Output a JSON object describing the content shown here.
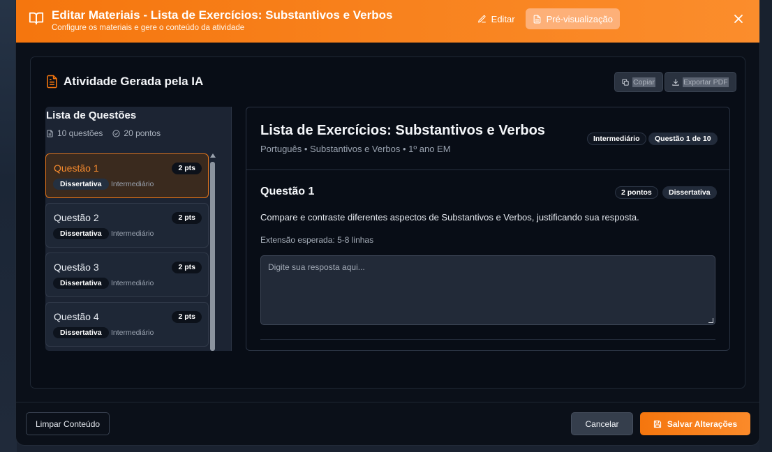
{
  "header": {
    "title": "Editar Materiais - Lista de Exercícios: Substantivos e Verbos",
    "subtitle": "Configure os materiais e gere o conteúdo da atividade",
    "edit_label": "Editar",
    "preview_label": "Pré-visualização",
    "close_icon": "close-icon",
    "accent": "#f5760e"
  },
  "card": {
    "title": "Atividade Gerada pela IA",
    "copy_label": "Copiar",
    "export_label": "Exportar PDF"
  },
  "list": {
    "title": "Lista de Questões",
    "count_label": "10 questões",
    "points_label": "20 pontos",
    "items": [
      {
        "name": "Questão 1",
        "points": "2 pts",
        "type": "Dissertativa",
        "level": "Intermediário",
        "active": true
      },
      {
        "name": "Questão 2",
        "points": "2 pts",
        "type": "Dissertativa",
        "level": "Intermediário",
        "active": false
      },
      {
        "name": "Questão 3",
        "points": "2 pts",
        "type": "Dissertativa",
        "level": "Intermediário",
        "active": false
      },
      {
        "name": "Questão 4",
        "points": "2 pts",
        "type": "Dissertativa",
        "level": "Intermediário",
        "active": false
      }
    ]
  },
  "detail": {
    "title": "Lista de Exercícios: Substantivos e Verbos",
    "subtitle": "Português • Substantivos e Verbos • 1º ano EM",
    "level_badge": "Intermediário",
    "progress_badge": "Questão 1 de 10",
    "question": {
      "heading": "Questão 1",
      "points_badge": "2 pontos",
      "type_badge": "Dissertativa",
      "text": "Compare e contraste diferentes aspectos de Substantivos e Verbos, justificando sua resposta.",
      "extent": "Extensão esperada: 5-8 linhas",
      "answer_placeholder": "Digite sua resposta aqui..."
    }
  },
  "footer": {
    "clear_label": "Limpar Conteúdo",
    "cancel_label": "Cancelar",
    "save_label": "Salvar Alterações"
  }
}
